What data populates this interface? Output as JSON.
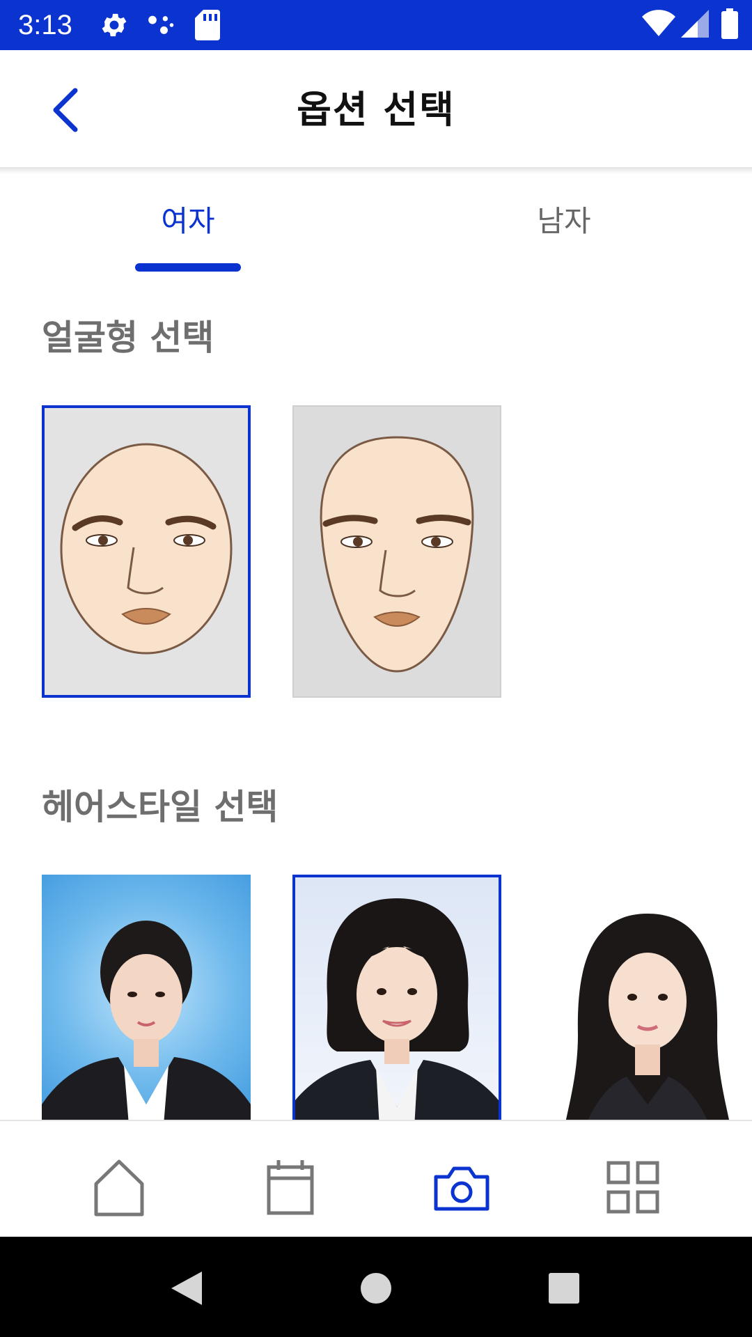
{
  "status_bar": {
    "time": "3:13",
    "icons": [
      "gear-icon",
      "assistant-dots-icon",
      "sd-card-icon",
      "wifi-icon",
      "cell-signal-icon",
      "battery-icon"
    ]
  },
  "app_bar": {
    "title": "옵션 선택",
    "back_icon": "chevron-left-icon"
  },
  "tabs": [
    {
      "label": "여자",
      "selected": true
    },
    {
      "label": "남자",
      "selected": false
    }
  ],
  "face_section": {
    "title": "얼굴형 선택",
    "options": [
      {
        "shape": "round-face",
        "selected": true
      },
      {
        "shape": "oval-face",
        "selected": false
      }
    ]
  },
  "hair_section": {
    "title": "헤어스타일 선택",
    "options": [
      {
        "style": "updo-blue-background",
        "selected": false
      },
      {
        "style": "short-bob",
        "selected": true
      },
      {
        "style": "long-straight",
        "selected": false
      }
    ]
  },
  "bottom_nav": [
    {
      "icon": "home-icon",
      "active": false
    },
    {
      "icon": "calendar-icon",
      "active": false
    },
    {
      "icon": "camera-icon",
      "active": true
    },
    {
      "icon": "grid-icon",
      "active": false
    }
  ],
  "system_nav": [
    "back-triangle-icon",
    "home-circle-icon",
    "recents-square-icon"
  ],
  "colors": {
    "accent": "#0b33cf",
    "inactive": "#777777",
    "section_title": "#6e6e6e"
  }
}
